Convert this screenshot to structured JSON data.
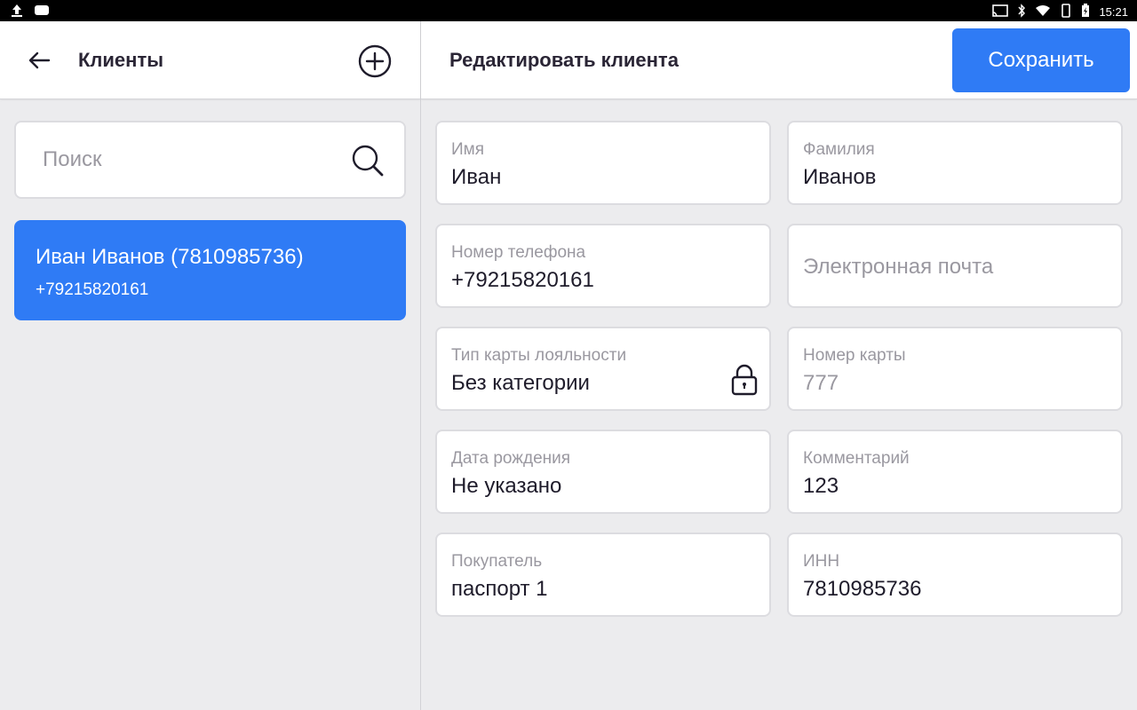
{
  "status_bar": {
    "time": "15:21",
    "left_icons": [
      "upload-icon",
      "message-icon"
    ],
    "right_icons": [
      "cast-icon",
      "bluetooth-icon",
      "wifi-icon",
      "vibrate-icon",
      "battery-charging-icon"
    ]
  },
  "left_panel": {
    "title": "Клиенты",
    "search": {
      "placeholder": "Поиск",
      "value": ""
    },
    "clients": [
      {
        "name": "Иван Иванов (7810985736)",
        "phone": "+79215820161",
        "selected": true
      }
    ]
  },
  "right_panel": {
    "title": "Редактировать клиента",
    "save_label": "Сохранить",
    "fields": {
      "first_name": {
        "label": "Имя",
        "value": "Иван"
      },
      "last_name": {
        "label": "Фамилия",
        "value": "Иванов"
      },
      "phone": {
        "label": "Номер телефона",
        "value": "+79215820161"
      },
      "email": {
        "placeholder": "Электронная почта",
        "value": ""
      },
      "loyalty_type": {
        "label": "Тип карты лояльности",
        "value": "Без категории",
        "locked": true
      },
      "card_number": {
        "label": "Номер карты",
        "value": "777"
      },
      "birth_date": {
        "label": "Дата рождения",
        "value": "Не указано"
      },
      "comment": {
        "label": "Комментарий",
        "value": "123"
      },
      "buyer": {
        "label": "Покупатель",
        "value": "паспорт 1"
      },
      "inn": {
        "label": "ИНН",
        "value": "7810985736"
      }
    }
  },
  "colors": {
    "accent": "#2f7bf5",
    "background": "#ececee",
    "text": "#1f1c2b",
    "muted": "#9a98a0"
  }
}
